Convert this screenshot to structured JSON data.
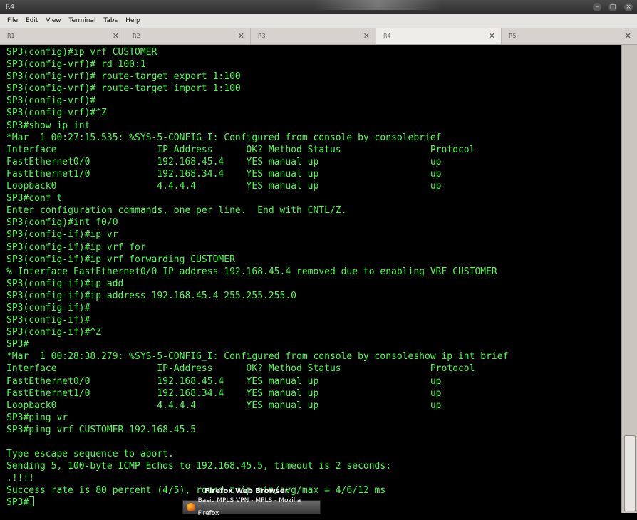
{
  "window": {
    "title": "R4",
    "controls": [
      "–",
      "□",
      "×"
    ]
  },
  "menu": [
    "File",
    "Edit",
    "View",
    "Terminal",
    "Tabs",
    "Help"
  ],
  "tabs": [
    {
      "label": "R1",
      "active": false
    },
    {
      "label": "R2",
      "active": false
    },
    {
      "label": "R3",
      "active": false
    },
    {
      "label": "R4",
      "active": true
    },
    {
      "label": "R5",
      "active": false
    }
  ],
  "terminal": {
    "lines": [
      "SP3(config)#ip vrf CUSTOMER",
      "SP3(config-vrf)# rd 100:1",
      "SP3(config-vrf)# route-target export 1:100",
      "SP3(config-vrf)# route-target import 1:100",
      "SP3(config-vrf)#",
      "SP3(config-vrf)#^Z",
      "SP3#show ip int",
      "*Mar  1 00:27:15.535: %SYS-5-CONFIG_I: Configured from console by consolebrief",
      "Interface                  IP-Address      OK? Method Status                Protocol",
      "FastEthernet0/0            192.168.45.4    YES manual up                    up",
      "FastEthernet1/0            192.168.34.4    YES manual up                    up",
      "Loopback0                  4.4.4.4         YES manual up                    up",
      "SP3#conf t",
      "Enter configuration commands, one per line.  End with CNTL/Z.",
      "SP3(config)#int f0/0",
      "SP3(config-if)#ip vr",
      "SP3(config-if)#ip vrf for",
      "SP3(config-if)#ip vrf forwarding CUSTOMER",
      "% Interface FastEthernet0/0 IP address 192.168.45.4 removed due to enabling VRF CUSTOMER",
      "SP3(config-if)#ip add",
      "SP3(config-if)#ip address 192.168.45.4 255.255.255.0",
      "SP3(config-if)#",
      "SP3(config-if)#",
      "SP3(config-if)#^Z",
      "SP3#",
      "*Mar  1 00:28:38.279: %SYS-5-CONFIG_I: Configured from console by consoleshow ip int brief",
      "Interface                  IP-Address      OK? Method Status                Protocol",
      "FastEthernet0/0            192.168.45.4    YES manual up                    up",
      "FastEthernet1/0            192.168.34.4    YES manual up                    up",
      "Loopback0                  4.4.4.4         YES manual up                    up",
      "SP3#ping vr",
      "SP3#ping vrf CUSTOMER 192.168.45.5",
      "",
      "Type escape sequence to abort.",
      "Sending 5, 100-byte ICMP Echos to 192.168.45.5, timeout is 2 seconds:",
      ".!!!!",
      "Success rate is 80 percent (4/5), round-trip min/avg/max = 4/6/12 ms"
    ],
    "prompt": "SP3#"
  },
  "taskbar": {
    "tooltip": "Firefox Web Browser",
    "button_label": "Basic MPLS VPN - MPLS - Mozilla Firefox"
  }
}
